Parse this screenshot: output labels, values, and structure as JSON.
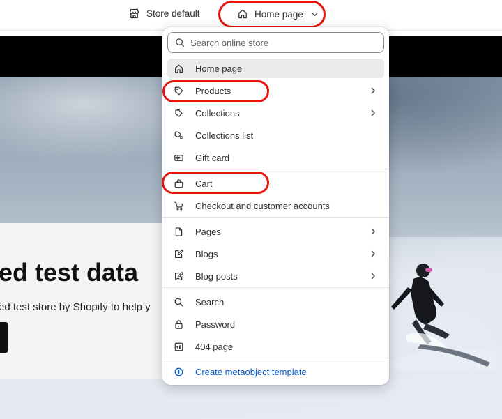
{
  "topbar": {
    "store_label": "Store default",
    "template_select": "Home page"
  },
  "hero": {
    "title": "ed test data",
    "subtitle": "ed test store by Shopify to help y"
  },
  "menu": {
    "search_placeholder": "Search online store",
    "groups": [
      {
        "items": [
          {
            "label": "Home page",
            "icon": "home-icon",
            "active": true,
            "has_arrow": false
          },
          {
            "label": "Products",
            "icon": "tag-icon",
            "has_arrow": true
          },
          {
            "label": "Collections",
            "icon": "collection-icon",
            "has_arrow": true
          },
          {
            "label": "Collections list",
            "icon": "collections-list-icon",
            "has_arrow": false
          },
          {
            "label": "Gift card",
            "icon": "gift-card-icon",
            "has_arrow": false
          }
        ]
      },
      {
        "items": [
          {
            "label": "Cart",
            "icon": "bag-icon",
            "has_arrow": false
          },
          {
            "label": "Checkout and customer accounts",
            "icon": "cart-icon",
            "has_arrow": false
          }
        ]
      },
      {
        "items": [
          {
            "label": "Pages",
            "icon": "page-icon",
            "has_arrow": true
          },
          {
            "label": "Blogs",
            "icon": "blog-icon",
            "has_arrow": true
          },
          {
            "label": "Blog posts",
            "icon": "blog-post-icon",
            "has_arrow": true
          }
        ]
      },
      {
        "items": [
          {
            "label": "Search",
            "icon": "search-icon",
            "has_arrow": false
          },
          {
            "label": "Password",
            "icon": "lock-icon",
            "has_arrow": false
          },
          {
            "label": "404 page",
            "icon": "page-404-icon",
            "has_arrow": false
          }
        ]
      }
    ],
    "create_link": "Create metaobject template"
  },
  "colors": {
    "highlight_ring": "#e8150c",
    "link": "#005bd3",
    "active_item_bg": "#ebebeb"
  }
}
